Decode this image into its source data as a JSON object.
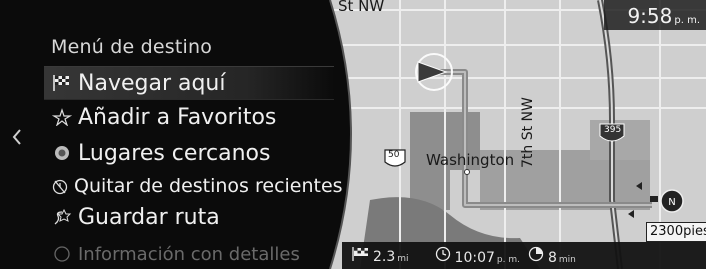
{
  "menu": {
    "title": "Menú de destino",
    "items": [
      {
        "label": "Navegar aquí",
        "icon": "checkered-flag-icon",
        "selected": true
      },
      {
        "label": "Añadir a Favoritos",
        "icon": "favorite-star-icon",
        "selected": false
      },
      {
        "label": "Lugares cercanos",
        "icon": "nearby-places-icon",
        "selected": false
      },
      {
        "label": "Quitar de destinos recientes",
        "icon": "remove-recent-icon",
        "selected": false
      },
      {
        "label": "Guardar ruta",
        "icon": "save-route-icon",
        "selected": false
      },
      {
        "label": "Información con detalles",
        "icon": "info-icon",
        "selected": false
      }
    ]
  },
  "status": {
    "time": "9:58",
    "ampm": "p. m."
  },
  "map": {
    "street_top": "St NW",
    "street_vertical": "7th St NW",
    "city": "Washington",
    "highway_shield": "50",
    "interstate_shield": "395"
  },
  "trip": {
    "distance_value": "2.3",
    "distance_unit": "mi",
    "eta_time": "10:07",
    "eta_ampm": "p. m.",
    "duration_value": "8",
    "duration_unit": "min"
  },
  "scale": {
    "label": "2300pies"
  },
  "colors": {
    "route": "#8a8a8a",
    "map_bg": "#c9c9c9",
    "panel_bg": "#0b0b0b"
  }
}
